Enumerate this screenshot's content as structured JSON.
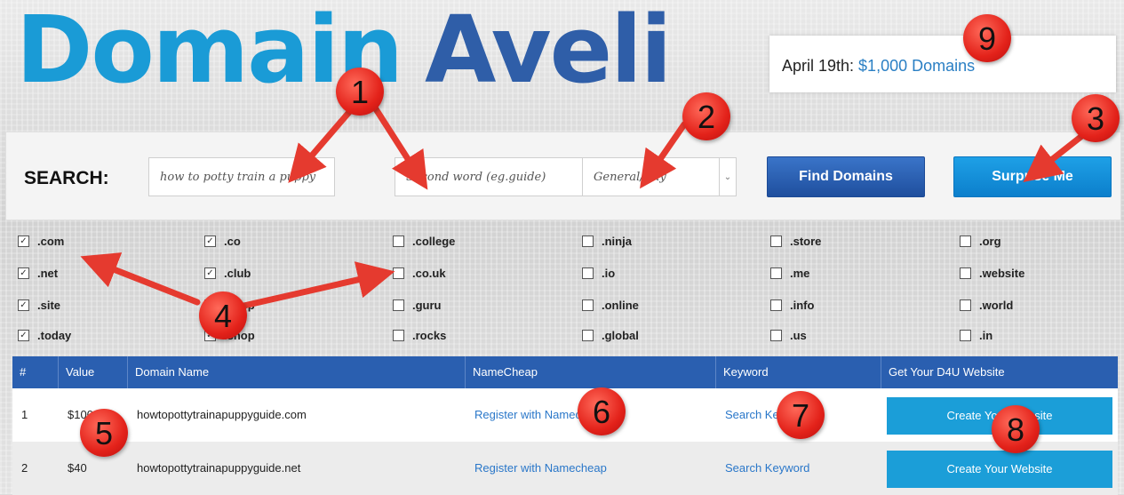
{
  "logo": {
    "word1": "Domain",
    "word2": "Aveli"
  },
  "announcement": {
    "prefix": "April 19th: ",
    "link": "$1,000 Domains"
  },
  "search": {
    "label": "SEARCH:",
    "keyword_value": "how to potty train a puppy",
    "second_word_placeholder": "Second word (eg.guide)",
    "category_selected": "General/Any",
    "find_button": "Find Domains",
    "surprise_button": "Surprise Me"
  },
  "tlds": [
    {
      "label": ".com",
      "checked": true
    },
    {
      "label": ".co",
      "checked": true
    },
    {
      "label": ".college",
      "checked": false
    },
    {
      "label": ".ninja",
      "checked": false
    },
    {
      "label": ".store",
      "checked": false
    },
    {
      "label": ".org",
      "checked": false
    },
    {
      "label": ".net",
      "checked": true
    },
    {
      "label": ".club",
      "checked": true
    },
    {
      "label": ".co.uk",
      "checked": false
    },
    {
      "label": ".io",
      "checked": false
    },
    {
      "label": ".me",
      "checked": false
    },
    {
      "label": ".website",
      "checked": false
    },
    {
      "label": ".site",
      "checked": true
    },
    {
      "label": ".shop",
      "checked": true
    },
    {
      "label": ".guru",
      "checked": false
    },
    {
      "label": ".online",
      "checked": false
    },
    {
      "label": ".info",
      "checked": false
    },
    {
      "label": ".world",
      "checked": false
    },
    {
      "label": ".today",
      "checked": true
    },
    {
      "label": ".shop",
      "checked": true
    },
    {
      "label": ".rocks",
      "checked": false
    },
    {
      "label": ".global",
      "checked": false
    },
    {
      "label": ".us",
      "checked": false
    },
    {
      "label": ".in",
      "checked": false
    }
  ],
  "table": {
    "headers": [
      "#",
      "Value",
      "Domain Name",
      "NameCheap",
      "Keyword",
      "Get Your D4U Website"
    ],
    "rows": [
      {
        "num": "1",
        "value": "$100",
        "domain": "howtopottytrainapuppyguide.com",
        "namecheap": "Register with Namecheap",
        "keyword": "Search Keyword",
        "cta": "Create Your Website"
      },
      {
        "num": "2",
        "value": "$40",
        "domain": "howtopottytrainapuppyguide.net",
        "namecheap": "Register with Namecheap",
        "keyword": "Search Keyword",
        "cta": "Create Your Website"
      }
    ]
  },
  "callouts": [
    "1",
    "2",
    "3",
    "4",
    "5",
    "6",
    "7",
    "8",
    "9"
  ],
  "colors": {
    "logo_light": "#1a9bd6",
    "logo_dark": "#2f5ea8",
    "header_bg": "#2a5fb0",
    "cta_bg": "#1b9ed8",
    "callout": "#e3221a"
  }
}
